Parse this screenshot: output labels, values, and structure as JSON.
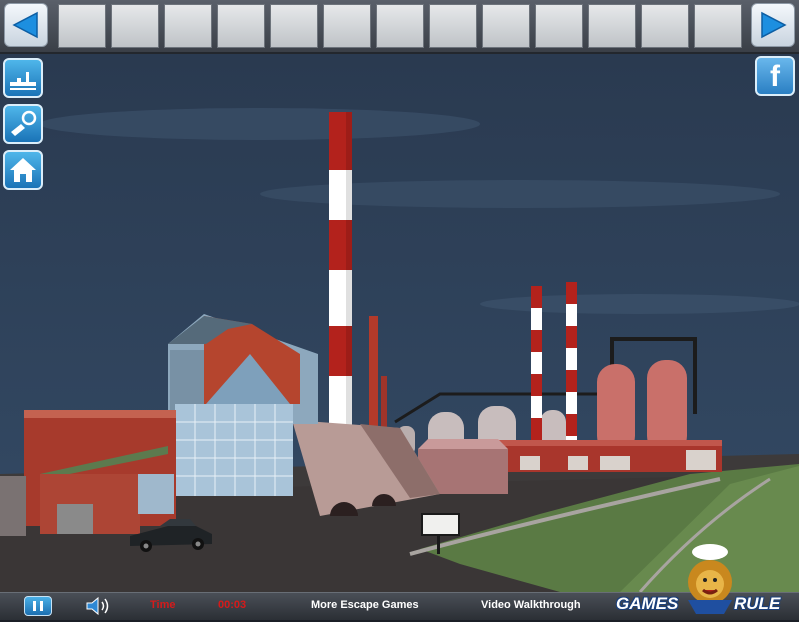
{
  "inventory": {
    "slot_count": 13
  },
  "side_buttons": [
    {
      "name": "walkthrough-icon"
    },
    {
      "name": "hint-icon"
    },
    {
      "name": "home-icon"
    }
  ],
  "facebook": {
    "label": "f"
  },
  "bottom_bar": {
    "time_label": "Time",
    "time_value": "00:03",
    "more_games": "More Escape Games",
    "walkthrough": "Video Walkthrough"
  },
  "logo": {
    "left": "GAMES",
    "right": "RULE"
  },
  "scene": {
    "description_sign": ""
  },
  "colors": {
    "sky": "#2d4057",
    "accent_red": "#b3221c",
    "button_blue": "#1a73b7"
  }
}
